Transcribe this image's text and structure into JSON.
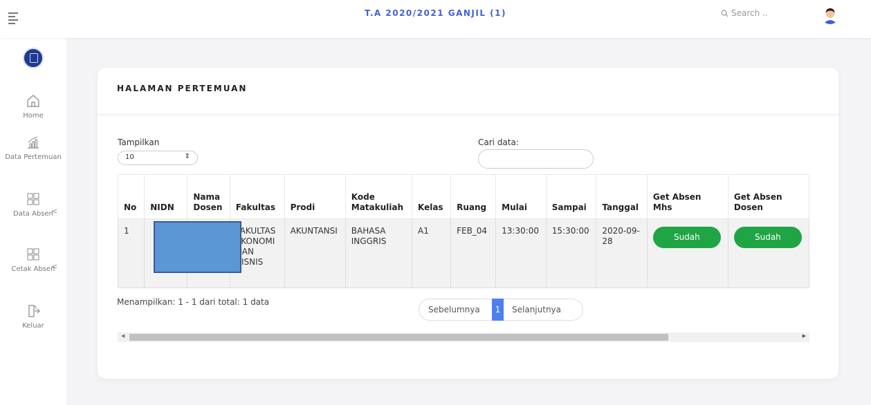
{
  "topbar": {
    "term": "T.A 2020/2021 GANJIL (1)",
    "search_placeholder": "Search ..",
    "accent": "#4160d8"
  },
  "sidebar": {
    "items": [
      {
        "label": "Home",
        "icon": "home-icon"
      },
      {
        "label": "Data Pertemuan",
        "icon": "chart-icon"
      },
      {
        "label": "Data Absen",
        "icon": "grid-icon"
      },
      {
        "label": "Cetak Absen",
        "icon": "grid-icon"
      },
      {
        "label": "Keluar",
        "icon": "logout-icon"
      }
    ]
  },
  "main": {
    "title": "HALAMAN PERTEMUAN",
    "show_label": "Tampilkan",
    "show_value": "10",
    "search_label": "Cari data:",
    "search_value": "",
    "columns": [
      "No",
      "NIDN",
      "Nama Dosen",
      "Fakultas",
      "Prodi",
      "Kode Matakuliah",
      "Kelas",
      "Ruang",
      "Mulai",
      "Sampai",
      "Tanggal",
      "Get Absen Mhs",
      "Get Absen Dosen"
    ],
    "rows": [
      {
        "no": "1",
        "nidn": "",
        "nama_dosen": "",
        "fakultas": "FAKULTAS EKONOMI DAN BISNIS",
        "prodi": "AKUNTANSI",
        "kode_matakuliah": "BAHASA INGGRIS",
        "kelas": "A1",
        "ruang": "FEB_04",
        "mulai": "13:30:00",
        "sampai": "15:30:00",
        "tanggal": "2020-09-28",
        "absen_mhs": "Sudah",
        "absen_dosen": "Sudah"
      }
    ],
    "info": "Menampilkan: 1 - 1 dari total: 1 data",
    "pager": {
      "prev": "Sebelumnya",
      "current": "1",
      "next": "Selanjutnya"
    },
    "status_color": "#1fa544"
  }
}
